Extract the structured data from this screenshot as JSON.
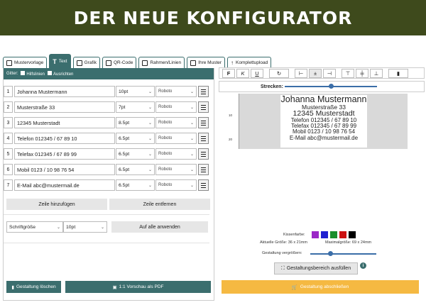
{
  "banner": {
    "title": "DER NEUE KONFIGURATOR"
  },
  "tabs": [
    {
      "label": "Mustervorlage",
      "icon": "grid-icon"
    },
    {
      "label": "Text",
      "icon": "text-t-icon"
    },
    {
      "label": "Grafik",
      "icon": "image-icon"
    },
    {
      "label": "QR-Code",
      "icon": "qr-code-icon"
    },
    {
      "label": "Rahmen/Linien",
      "icon": "frame-icon"
    },
    {
      "label": "Ihre Muster",
      "icon": "folder-icon"
    },
    {
      "label": "Komplettupload",
      "icon": "upload-icon"
    }
  ],
  "gitter": {
    "label": "Gitter:",
    "hilfslinien": "Hilfslinien",
    "ausrichten": "Ausrichten"
  },
  "rows": [
    {
      "num": "1",
      "text": "Johanna Mustermann",
      "size": "10pt",
      "font": "Roboto"
    },
    {
      "num": "2",
      "text": "Musterstraße 33",
      "size": "7pt",
      "font": "Roboto"
    },
    {
      "num": "3",
      "text": "12345 Musterstadt",
      "size": "8.5pt",
      "font": "Roboto"
    },
    {
      "num": "4",
      "text": "Telefon 012345 / 67 89 10",
      "size": "6.5pt",
      "font": "Roboto"
    },
    {
      "num": "5",
      "text": "Telefax 012345 / 67 89 99",
      "size": "6.5pt",
      "font": "Roboto"
    },
    {
      "num": "6",
      "text": "Mobil 0123 / 10 98 76 54",
      "size": "6.5pt",
      "font": "Roboto"
    },
    {
      "num": "7",
      "text": "E-Mail abc@mustermail.de",
      "size": "6.5pt",
      "font": "Roboto"
    }
  ],
  "buttons": {
    "add_row": "Zeile hinzufügen",
    "remove_row": "Zeile entfernen",
    "apply_all": "Auf alle anwenden",
    "delete_design": "Gestaltung löschen",
    "preview_pdf": "1:1 Vorschau als PDF",
    "fill_area": "Gestaltungsbereich ausfüllen",
    "finish": "Gestaltung abschließen"
  },
  "bulk": {
    "property": "Schriftgröße",
    "value": "10pt"
  },
  "toolbar": {
    "bold": "F",
    "italic": "K",
    "underline": "U"
  },
  "strecken": {
    "label": "Strecken:",
    "value": 0.5
  },
  "preview": {
    "lines": [
      {
        "text": "Johanna Mustermann",
        "size": 12.5
      },
      {
        "text": "Musterstraße 33",
        "size": 8.5
      },
      {
        "text": "12345 Musterstadt",
        "size": 10.5
      },
      {
        "text": "Telefon 012345 / 67 89 10",
        "size": 8
      },
      {
        "text": "Telefax 012345 / 67 89 99",
        "size": 8
      },
      {
        "text": "Mobil 0123 / 10 98 76 54",
        "size": 8
      },
      {
        "text": "E-Mail abc@mustermail.de",
        "size": 8
      }
    ],
    "ruler": [
      "10",
      "20"
    ]
  },
  "info": {
    "kissenfarbe": "Kissenfarbe:",
    "aktuelle": "Aktuelle Größe:",
    "aktuelle_val": "36 x 21mm",
    "maximal": "Maximalgröße:",
    "maximal_val": "69 x 24mm",
    "vergroessern": "Gestaltung vergrößern:",
    "vergroessern_value": 0.3
  },
  "colors": {
    "teal": "#3b6e6e",
    "banner": "#3e4a1c",
    "orange": "#f5b942",
    "swatches": [
      "#9b27c7",
      "#2020d0",
      "#1a8e2c",
      "#cc1111",
      "#000000"
    ]
  }
}
